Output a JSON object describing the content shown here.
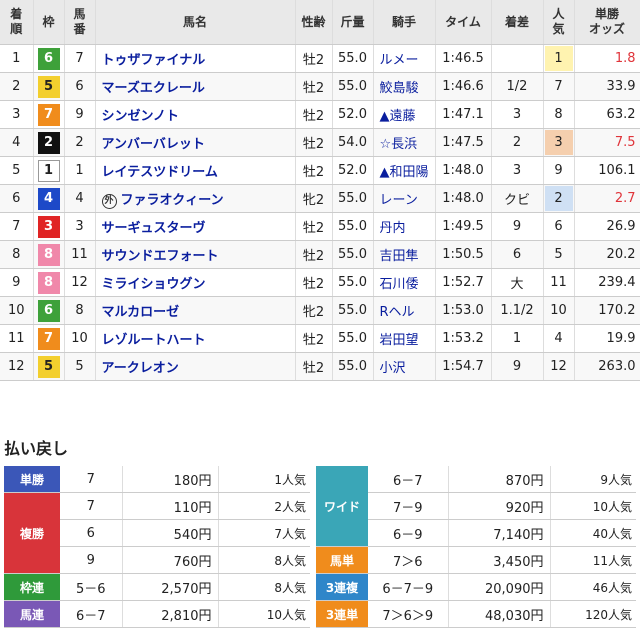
{
  "headers": {
    "rank": [
      "着",
      "順"
    ],
    "frame": "枠",
    "num": [
      "馬",
      "番"
    ],
    "horse": "馬名",
    "sexage": "性齢",
    "weight": "斤量",
    "jockey": "騎手",
    "time": "タイム",
    "margin": "着差",
    "pop": [
      "人",
      "気"
    ],
    "odds": [
      "単勝",
      "オッズ"
    ]
  },
  "frame_colors": {
    "1": {
      "bg": "#ffffff",
      "fg": "#222222",
      "border": "#999999"
    },
    "2": {
      "bg": "#111111",
      "fg": "#ffffff"
    },
    "3": {
      "bg": "#e02424",
      "fg": "#ffffff"
    },
    "4": {
      "bg": "#1d49c8",
      "fg": "#ffffff"
    },
    "5": {
      "bg": "#f3cf2e",
      "fg": "#222222"
    },
    "6": {
      "bg": "#3ea13a",
      "fg": "#ffffff"
    },
    "7": {
      "bg": "#f08c1c",
      "fg": "#ffffff"
    },
    "8": {
      "bg": "#f088aa",
      "fg": "#ffffff"
    }
  },
  "results": [
    {
      "rank": "1",
      "frame": "6",
      "num": "7",
      "horse": "トゥザファイナル",
      "gai": "",
      "sexage": "牡2",
      "weight": "55.0",
      "jockey": "ルメー",
      "time": "1:46.5",
      "margin": "",
      "pop": "1",
      "odds": "1.8",
      "odds_hi": true
    },
    {
      "rank": "2",
      "frame": "5",
      "num": "6",
      "horse": "マーズエクレール",
      "gai": "",
      "sexage": "牡2",
      "weight": "55.0",
      "jockey": "鮫島駿",
      "time": "1:46.6",
      "margin": "1/2",
      "pop": "7",
      "odds": "33.9",
      "odds_hi": false
    },
    {
      "rank": "3",
      "frame": "7",
      "num": "9",
      "horse": "シンゼンノト",
      "gai": "",
      "sexage": "牡2",
      "weight": "52.0",
      "jockey": "▲遠藤",
      "time": "1:47.1",
      "margin": "3",
      "pop": "8",
      "odds": "63.2",
      "odds_hi": false
    },
    {
      "rank": "4",
      "frame": "2",
      "num": "2",
      "horse": "アンバーバレット",
      "gai": "",
      "sexage": "牡2",
      "weight": "54.0",
      "jockey": "☆長浜",
      "time": "1:47.5",
      "margin": "2",
      "pop": "3",
      "odds": "7.5",
      "odds_hi": true
    },
    {
      "rank": "5",
      "frame": "1",
      "num": "1",
      "horse": "レイテスツドリーム",
      "gai": "",
      "sexage": "牡2",
      "weight": "52.0",
      "jockey": "▲和田陽",
      "time": "1:48.0",
      "margin": "3",
      "pop": "9",
      "odds": "106.1",
      "odds_hi": false
    },
    {
      "rank": "6",
      "frame": "4",
      "num": "4",
      "horse": "ファラオクィーン",
      "gai": "外",
      "sexage": "牝2",
      "weight": "55.0",
      "jockey": "レーン",
      "time": "1:48.0",
      "margin": "クビ",
      "pop": "2",
      "odds": "2.7",
      "odds_hi": true
    },
    {
      "rank": "7",
      "frame": "3",
      "num": "3",
      "horse": "サーギュスターヴ",
      "gai": "",
      "sexage": "牡2",
      "weight": "55.0",
      "jockey": "丹内",
      "time": "1:49.5",
      "margin": "9",
      "pop": "6",
      "odds": "26.9",
      "odds_hi": false
    },
    {
      "rank": "8",
      "frame": "8",
      "num": "11",
      "horse": "サウンドエフォート",
      "gai": "",
      "sexage": "牡2",
      "weight": "55.0",
      "jockey": "吉田隼",
      "time": "1:50.5",
      "margin": "6",
      "pop": "5",
      "odds": "20.2",
      "odds_hi": false
    },
    {
      "rank": "9",
      "frame": "8",
      "num": "12",
      "horse": "ミライショウグン",
      "gai": "",
      "sexage": "牡2",
      "weight": "55.0",
      "jockey": "石川倭",
      "time": "1:52.7",
      "margin": "大",
      "pop": "11",
      "odds": "239.4",
      "odds_hi": false
    },
    {
      "rank": "10",
      "frame": "6",
      "num": "8",
      "horse": "マルカローゼ",
      "gai": "",
      "sexage": "牝2",
      "weight": "55.0",
      "jockey": "Rヘル",
      "time": "1:53.0",
      "margin": "1.1/2",
      "pop": "10",
      "odds": "170.2",
      "odds_hi": false
    },
    {
      "rank": "11",
      "frame": "7",
      "num": "10",
      "horse": "レゾルートハート",
      "gai": "",
      "sexage": "牡2",
      "weight": "55.0",
      "jockey": "岩田望",
      "time": "1:53.2",
      "margin": "1",
      "pop": "4",
      "odds": "19.9",
      "odds_hi": false
    },
    {
      "rank": "12",
      "frame": "5",
      "num": "5",
      "horse": "アークレオン",
      "gai": "",
      "sexage": "牡2",
      "weight": "55.0",
      "jockey": "小沢",
      "time": "1:54.7",
      "margin": "9",
      "pop": "12",
      "odds": "263.0",
      "odds_hi": false
    }
  ],
  "payout_title": "払い戻し",
  "payout_left": [
    {
      "type": "単勝",
      "color": "#3b57b8",
      "rows": [
        {
          "combo": "7",
          "yen": "180円",
          "pop": "1人気"
        }
      ]
    },
    {
      "type": "複勝",
      "color": "#d8343a",
      "rows": [
        {
          "combo": "7",
          "yen": "110円",
          "pop": "2人気"
        },
        {
          "combo": "6",
          "yen": "540円",
          "pop": "7人気"
        },
        {
          "combo": "9",
          "yen": "760円",
          "pop": "8人気"
        }
      ]
    },
    {
      "type": "枠連",
      "color": "#2f9a3a",
      "rows": [
        {
          "combo": "5－6",
          "yen": "2,570円",
          "pop": "8人気"
        }
      ]
    },
    {
      "type": "馬連",
      "color": "#7a58b6",
      "rows": [
        {
          "combo": "6－7",
          "yen": "2,810円",
          "pop": "10人気"
        }
      ]
    }
  ],
  "payout_right": [
    {
      "type": "ワイド",
      "color": "#3aa6b7",
      "rows": [
        {
          "combo": "6－7",
          "yen": "870円",
          "pop": "9人気"
        },
        {
          "combo": "7－9",
          "yen": "920円",
          "pop": "10人気"
        },
        {
          "combo": "6－9",
          "yen": "7,140円",
          "pop": "40人気"
        }
      ]
    },
    {
      "type": "馬単",
      "color": "#f08c1c",
      "rows": [
        {
          "combo": "7＞6",
          "yen": "3,450円",
          "pop": "11人気"
        }
      ]
    },
    {
      "type": "3連複",
      "color": "#2f86c9",
      "rows": [
        {
          "combo": "6－7－9",
          "yen": "20,090円",
          "pop": "46人気"
        }
      ]
    },
    {
      "type": "3連単",
      "color": "#f08c1c",
      "rows": [
        {
          "combo": "7＞6＞9",
          "yen": "48,030円",
          "pop": "120人気"
        }
      ]
    }
  ]
}
